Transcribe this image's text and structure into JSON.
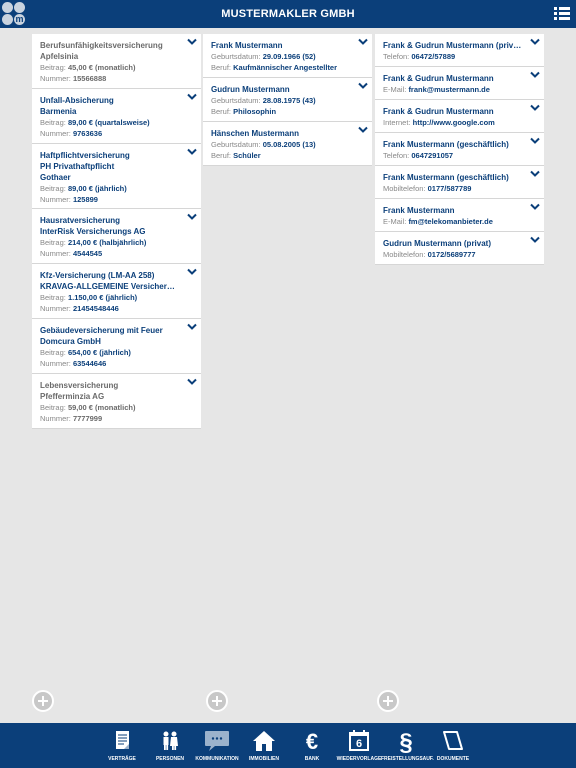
{
  "header": {
    "title": "MUSTERMAKLER GMBH",
    "logo_letter": "m"
  },
  "labels": {
    "beitrag": "Beitrag:",
    "nummer": "Nummer:",
    "geburtsdatum": "Geburtsdatum:",
    "beruf": "Beruf:"
  },
  "insurances": [
    {
      "type": "Berufsunfähigkeitsversicherung",
      "company": "Apfelsinia",
      "beitrag": "45,00 € (monatlich)",
      "nummer": "15566888",
      "greyed": true
    },
    {
      "type": "Unfall-Absicherung",
      "company": "Barmenia",
      "beitrag": "89,00 € (quartalsweise)",
      "nummer": "9763636",
      "greyed": false
    },
    {
      "type": "Haftpflichtversicherung",
      "line2": "PH Privathaftpflicht",
      "company": "Gothaer",
      "beitrag": "89,00 € (jährlich)",
      "nummer": "125899",
      "greyed": false
    },
    {
      "type": "Hausratversicherung",
      "company": "InterRisk Versicherungs AG",
      "beitrag": "214,00 € (halbjährlich)",
      "nummer": "4544545",
      "greyed": false
    },
    {
      "type": "Kfz-Versicherung (LM-AA 258)",
      "company": "KRAVAG-ALLGEMEINE VersicherungsAkti ...",
      "beitrag": "1.150,00 € (jährlich)",
      "nummer": "21454548446",
      "greyed": false
    },
    {
      "type": "Gebäudeversicherung mit Feuer",
      "company": "Domcura GmbH",
      "beitrag": "654,00 € (jährlich)",
      "nummer": "63544646",
      "greyed": false
    },
    {
      "type": "Lebensversicherung",
      "company": "Pfefferminzia AG",
      "beitrag": "59,00 € (monatlich)",
      "nummer": "7777999",
      "greyed": true
    }
  ],
  "persons": [
    {
      "name": "Frank Mustermann",
      "geburtsdatum": "29.09.1966 (52)",
      "beruf": "Kaufmännischer Angestellter"
    },
    {
      "name": "Gudrun Mustermann",
      "geburtsdatum": "28.08.1975 (43)",
      "beruf": "Philosophin"
    },
    {
      "name": "Hänschen Mustermann",
      "geburtsdatum": "05.08.2005 (13)",
      "beruf": "Schüler"
    }
  ],
  "contacts": [
    {
      "name": "Frank & Gudrun Mustermann (privat)",
      "label": "Telefon:",
      "value": "06472/57889"
    },
    {
      "name": "Frank & Gudrun Mustermann",
      "label": "E-Mail:",
      "value": "frank@mustermann.de"
    },
    {
      "name": "Frank & Gudrun Mustermann",
      "label": "Internet:",
      "value": "http://www.google.com"
    },
    {
      "name": "Frank Mustermann (geschäftlich)",
      "label": "Telefon:",
      "value": "0647291057"
    },
    {
      "name": "Frank Mustermann (geschäftlich)",
      "label": "Mobiltelefon:",
      "value": "0177/587789"
    },
    {
      "name": "Frank Mustermann",
      "label": "E-Mail:",
      "value": "fm@telekomanbieter.de"
    },
    {
      "name": "Gudrun Mustermann (privat)",
      "label": "Mobiltelefon:",
      "value": "0172/5689777"
    }
  ],
  "bottom_nav": [
    {
      "label": "Verträge",
      "icon": "document-icon",
      "active": false
    },
    {
      "label": "Personen",
      "icon": "persons-icon",
      "active": false
    },
    {
      "label": "Kommunikation",
      "icon": "chat-icon",
      "active": true
    },
    {
      "label": "Immobilien",
      "icon": "house-icon",
      "active": false
    },
    {
      "label": "Bank",
      "icon": "euro-icon",
      "active": false
    },
    {
      "label": "Wiedervorlage",
      "icon": "calendar-icon",
      "active": false,
      "calendar_day": "6"
    },
    {
      "label": "Freistellungsauf.",
      "icon": "paragraph-icon",
      "active": false
    },
    {
      "label": "Dokumente",
      "icon": "folder-icon",
      "active": false
    }
  ],
  "colors": {
    "primary": "#0b3f7a",
    "background": "#e6e6e6",
    "card": "#ffffff",
    "muted": "#888888"
  }
}
